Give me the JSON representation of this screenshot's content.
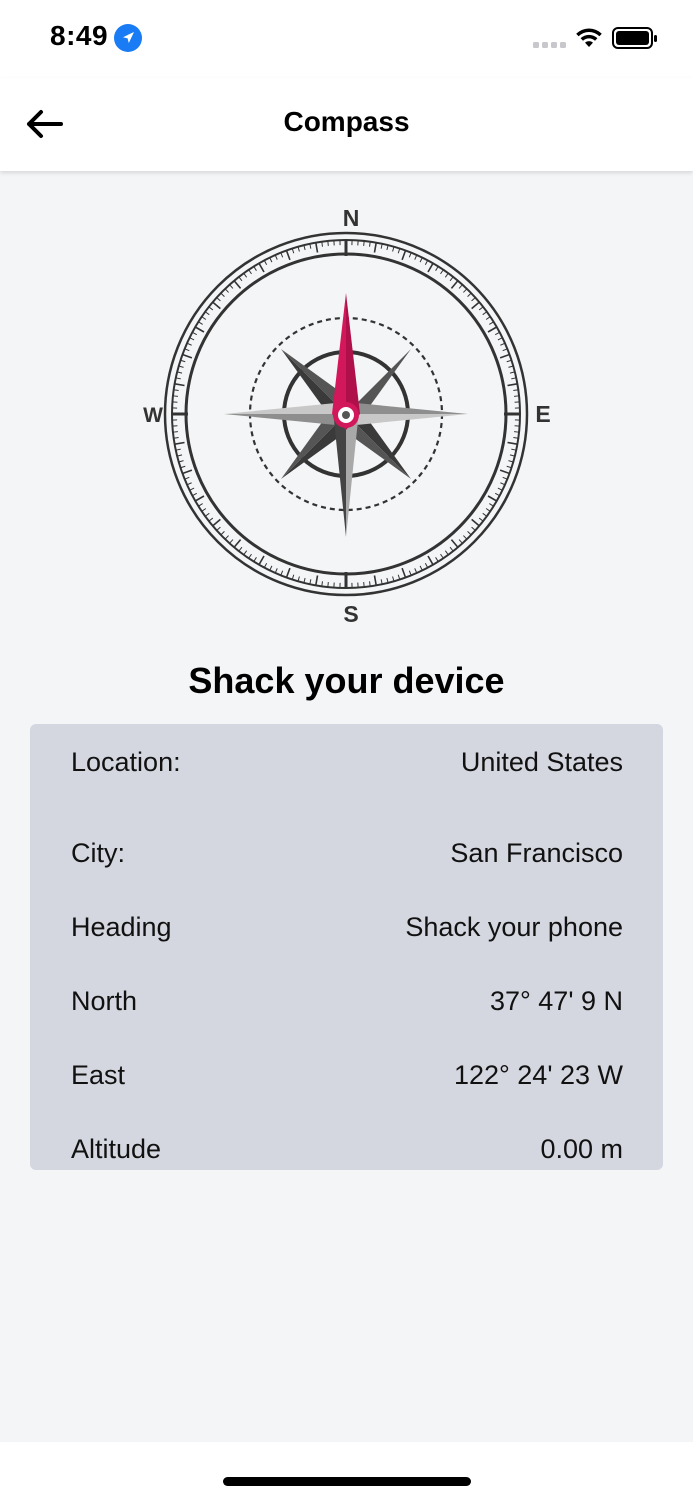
{
  "status_bar": {
    "time": "8:49"
  },
  "nav": {
    "title": "Compass"
  },
  "compass": {
    "north": "N",
    "south": "S",
    "east": "E",
    "west": "W",
    "needle_color": "#d2185a"
  },
  "headline": "Shack your device",
  "info": [
    {
      "label": "Location:",
      "value": "United States"
    },
    {
      "label": "City:",
      "value": "San Francisco"
    },
    {
      "label": "Heading",
      "value": "Shack your phone"
    },
    {
      "label": "North",
      "value": "37° 47' 9 N"
    },
    {
      "label": "East",
      "value": "122° 24' 23 W"
    },
    {
      "label": "Altitude",
      "value": "0.00 m"
    }
  ],
  "colors": {
    "background": "#f4f5f7",
    "card": "#d4d7e0",
    "accent": "#1a7cf5"
  }
}
